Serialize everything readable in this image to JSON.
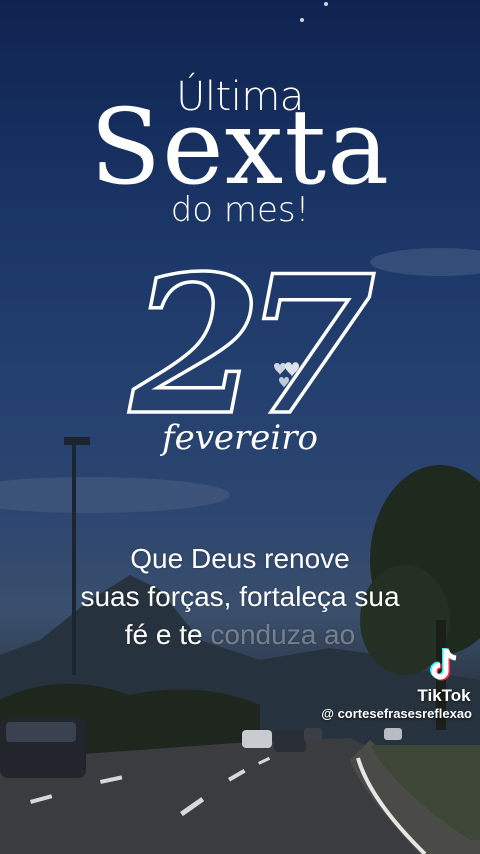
{
  "overlay": {
    "line1": "Última",
    "line2": "Sexta",
    "line3": "do mes!",
    "day": "27",
    "month": "fevereiro"
  },
  "caption": {
    "line1": "Que Deus renove",
    "line2": "suas forças, fortaleça sua",
    "line3_visible": "fé e te",
    "line3_faded": " conduza ao"
  },
  "watermark": {
    "brand": "TikTok",
    "handle": "@ cortesefrasesreflexao",
    "icon": "tiktok-logo-icon"
  },
  "colors": {
    "text": "#ffffff",
    "sky_top": "#0f2350",
    "sky_mid": "#24406f"
  }
}
